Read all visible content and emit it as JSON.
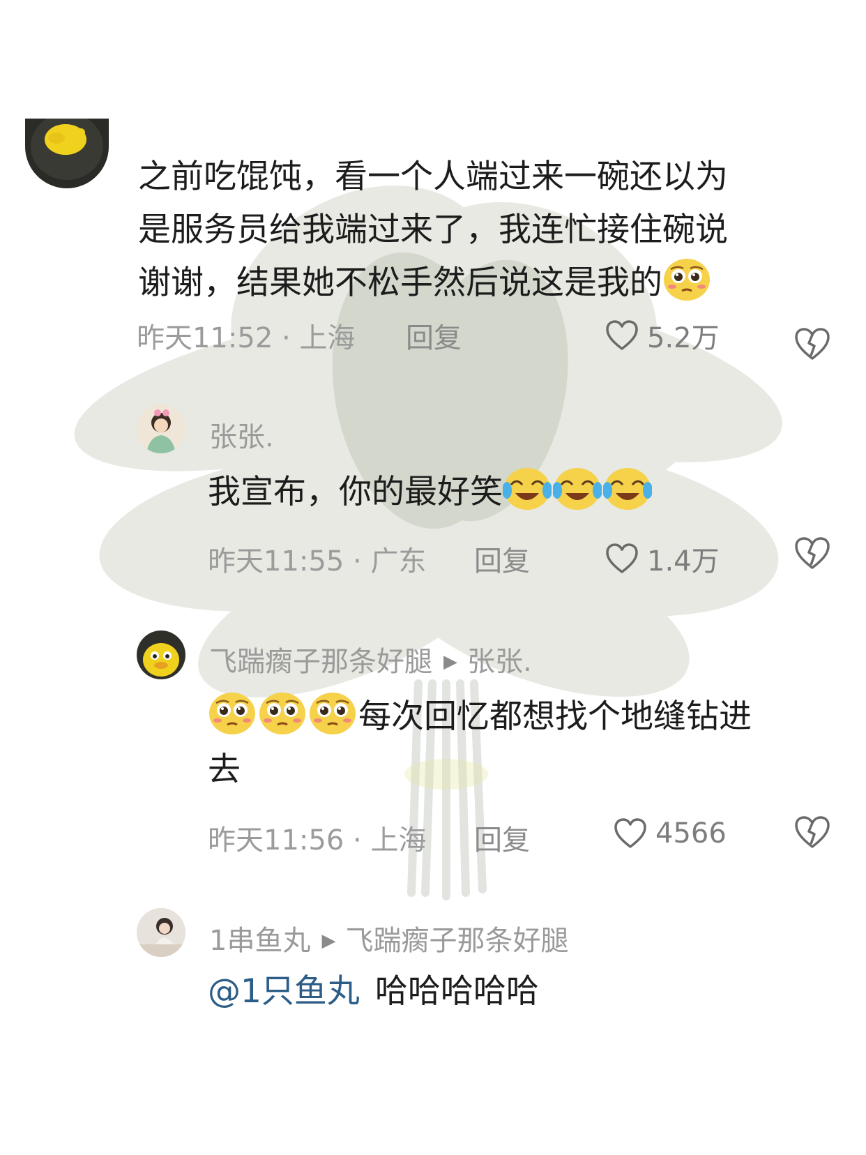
{
  "comments": [
    {
      "username": "",
      "text_lines": [
        "之前吃馄饨，看一个人端过来一碗还以为",
        "是服务员给我端过来了，我连忙接住碗说",
        "谢谢，结果她不松手然后说这是我的"
      ],
      "emojis": [
        "pleading-face"
      ],
      "time": "昨天11:52",
      "location": "上海",
      "reply_label": "回复",
      "likes": "5.2万"
    },
    {
      "username": "张张.",
      "text": "我宣布，你的最好笑",
      "emojis": [
        "tears-of-joy",
        "tears-of-joy",
        "tears-of-joy"
      ],
      "time": "昨天11:55",
      "location": "广东",
      "reply_label": "回复",
      "likes": "1.4万"
    },
    {
      "username": "飞踹瘸子那条好腿",
      "reply_to": "张张.",
      "emojis": [
        "pleading-face",
        "pleading-face",
        "pleading-face"
      ],
      "text_line1": "每次回忆都想找个地缝钻进",
      "text_line2": "去",
      "time": "昨天11:56",
      "location": "上海",
      "reply_label": "回复",
      "likes": "4566"
    },
    {
      "username": "1串鱼丸",
      "reply_to": "飞踹瘸子那条好腿",
      "mention": "@1只鱼丸",
      "text": "哈哈哈哈哈"
    }
  ],
  "separator": "·",
  "icons": {
    "like": "heart-outline-icon",
    "dislike": "broken-heart-icon",
    "reply_arrow": "play-triangle-icon"
  }
}
